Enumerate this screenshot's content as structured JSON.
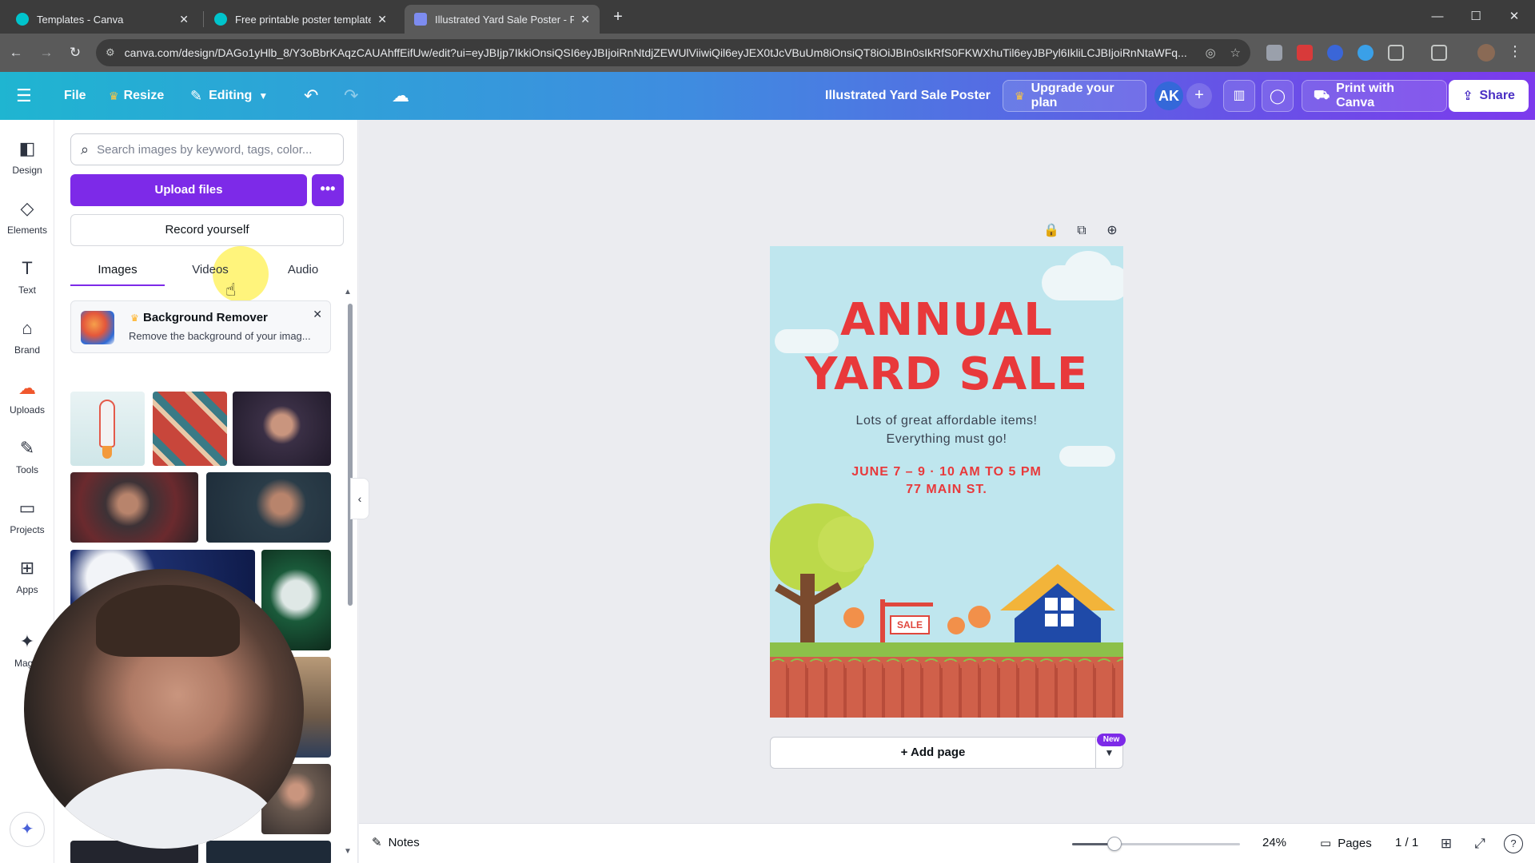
{
  "browser": {
    "tabs": [
      {
        "title": "Templates - Canva",
        "active": false
      },
      {
        "title": "Free printable poster templates",
        "active": false
      },
      {
        "title": "Illustrated Yard Sale Poster - Po",
        "active": true
      }
    ],
    "url": "canva.com/design/DAGo1yHlb_8/Y3oBbrKAqzCAUAhffEifUw/edit?ui=eyJBIjp7IkkiOnsiQSI6eyJBIjoiRnNtdjZEWUlViiwiQil6eyJEX0tJcVBuUm8iOnsiQT8iOiJBIn0sIkRfS0FKWXhuTil6eyJBPyl6IkliLCJBIjoiRnNtaWFq..."
  },
  "header": {
    "file": "File",
    "resize": "Resize",
    "editing": "Editing",
    "doc_title": "Illustrated Yard Sale Poster",
    "upgrade": "Upgrade your plan",
    "avatar_initials": "AK",
    "print": "Print with Canva",
    "share": "Share",
    "gradient": [
      "#1fb5d1",
      "#3f8ce0",
      "#6653e6",
      "#7c3aed"
    ]
  },
  "rail": {
    "items": [
      {
        "label": "Design",
        "icon": "design-icon"
      },
      {
        "label": "Elements",
        "icon": "elements-icon"
      },
      {
        "label": "Text",
        "icon": "text-icon"
      },
      {
        "label": "Brand",
        "icon": "brand-icon"
      },
      {
        "label": "Uploads",
        "icon": "uploads-icon"
      },
      {
        "label": "Tools",
        "icon": "tools-icon"
      },
      {
        "label": "Projects",
        "icon": "projects-icon"
      },
      {
        "label": "Apps",
        "icon": "apps-icon"
      },
      {
        "label": "Magic",
        "icon": "magic-media-icon"
      }
    ],
    "active": "Uploads"
  },
  "panel": {
    "search_placeholder": "Search images by keyword, tags, color...",
    "upload_label": "Upload files",
    "more_label": "•••",
    "record_label": "Record yourself",
    "tabs": [
      "Images",
      "Videos",
      "Audio"
    ],
    "active_tab": "Images",
    "bg_remover": {
      "title": "Background Remover",
      "desc": "Remove the background of your imag..."
    },
    "accent": "#7d2ae8"
  },
  "poster": {
    "title_line1": "ANNUAL",
    "title_line2": "YARD SALE",
    "sub_line1": "Lots of great affordable items!",
    "sub_line2": "Everything must go!",
    "date_line1": "JUNE 7 – 9 · 10 AM TO 5 PM",
    "date_line2": "77 MAIN ST.",
    "sign_text": "SALE",
    "title_color": "#e8393b",
    "sky_color": "#bfe6ee"
  },
  "canvas": {
    "add_page": "+ Add page",
    "new_badge": "New"
  },
  "bottom": {
    "notes": "Notes",
    "zoom": "24%",
    "zoom_value": 0.24,
    "pages": "Pages",
    "page_count": "1 / 1"
  }
}
